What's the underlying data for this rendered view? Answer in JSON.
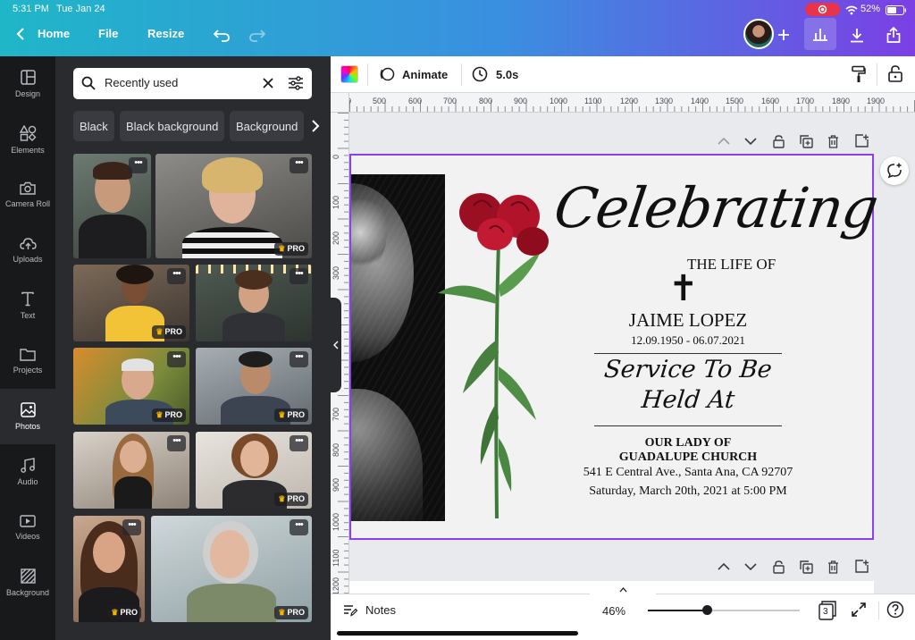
{
  "status": {
    "time": "5:31 PM",
    "date": "Tue Jan 24",
    "battery": "52%"
  },
  "topbar": {
    "home": "Home",
    "file": "File",
    "resize": "Resize"
  },
  "rail": [
    {
      "label": "Design"
    },
    {
      "label": "Elements"
    },
    {
      "label": "Camera Roll"
    },
    {
      "label": "Uploads"
    },
    {
      "label": "Text"
    },
    {
      "label": "Projects"
    },
    {
      "label": "Photos"
    },
    {
      "label": "Audio"
    },
    {
      "label": "Videos"
    },
    {
      "label": "Background"
    }
  ],
  "panel": {
    "search_value": "Recently used",
    "chips": [
      "Black",
      "Black background",
      "Background"
    ],
    "pro": "PRO"
  },
  "toolbar": {
    "animate": "Animate",
    "duration": "5.0s"
  },
  "ruler_h": [
    "0",
    "500",
    "600",
    "700",
    "800",
    "900",
    "1000",
    "1100",
    "1200",
    "1300",
    "1400",
    "1500",
    "1600",
    "1700",
    "1800",
    "1900"
  ],
  "ruler_v": [
    "0",
    "100",
    "200",
    "300",
    "400",
    "500",
    "600",
    "700",
    "800",
    "900",
    "1000",
    "1100",
    "1200"
  ],
  "card": {
    "celebrating": "Celebrating",
    "the_life_of": "THE LIFE OF",
    "cross": "✝",
    "name": "JAIME LOPEZ",
    "dates": "12.09.1950 - 06.07.2021",
    "service_line1": "Service To Be",
    "service_line2": "Held At",
    "church_line1": "OUR LADY OF",
    "church_line2": "GUADALUPE CHURCH",
    "address": "541 E Central Ave., Santa Ana, CA 92707",
    "datetime": "Saturday,  March 20th, 2021 at 5:00 PM"
  },
  "bottom": {
    "notes": "Notes",
    "zoom": "46%",
    "zoom_level": 0.39,
    "pages": "3"
  },
  "colors": {
    "accent": "#8a3ff0",
    "rail_bg": "#18191b",
    "panel_bg": "#2a2b2f",
    "rose": "#b1142a"
  }
}
